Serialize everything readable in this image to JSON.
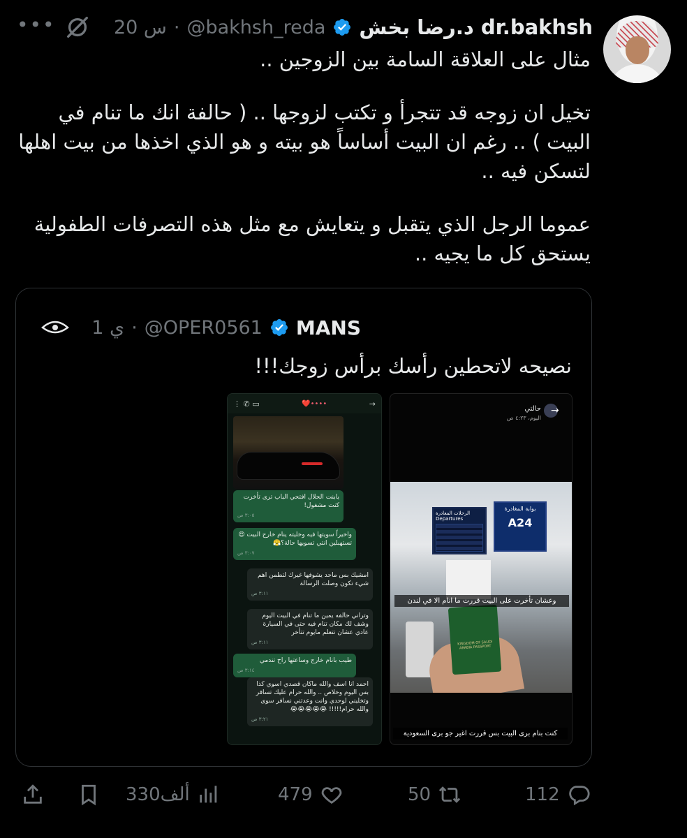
{
  "tweet": {
    "display_name": "د.رضا بخش dr.bakhsh",
    "handle": "@bakhsh_reda",
    "time": "20 س",
    "separator": "·",
    "more_label": "•••",
    "paragraphs": [
      "مثال على العلاقة السامة بين الزوجين ..",
      "تخيل ان زوجه قد تتجرأ و تكتب لزوجها .. ( حالفة انك ما تنام في البيت ) .. رغم ان البيت أساساً هو بيته و هو الذي اخذها من بيت اهلها لتسكن فيه ..",
      "عموما الرجل الذي يتقبل و يتعايش مع مثل هذه التصرفات الطفولية يستحق كل ما يجيه .."
    ]
  },
  "quote": {
    "display_name": "MANS",
    "handle": "@OPER0561",
    "time": "1 ي",
    "separator": "·",
    "text": "نصيحه لاتحطين رأسك برأس زوجك!!!",
    "left_image": {
      "contact": "❤️••••",
      "messages": [
        {
          "dir": "out",
          "text": "يابنت الحلال افتحي الباب ترى تأخرت كنت مشغول!",
          "time": "٣:٠٥ ص"
        },
        {
          "dir": "out",
          "text": "واخيراً سويتها فيه وخليته ينام خارج البيت 😍 تستهبلين انتي تسويها حالة؟😤",
          "time": "٣:٠٧ ص"
        },
        {
          "dir": "in",
          "text": "امشيك بس ماحد يشوفها غيرك لتطمن اهم شيء تكون وصلت الرسالة",
          "time": "٣:١١ ص"
        },
        {
          "dir": "in",
          "text": "وتراني حالفه يمين ما تنام في البيت اليوم وشف لك مكان تنام فيه حتى في السيارة عادي عشان تتعلم مايوم تتأخر",
          "time": "٣:١١ ص"
        },
        {
          "dir": "out",
          "text": "طيب بانام خارج وساعتها راح تندمي",
          "time": "٣:١٤ ص"
        },
        {
          "dir": "in",
          "text": "احمد انا اسف والله ماكان قصدي اسوي كذا بس اليوم وخلاص .. والله حرام عليك تسافر وتخليني لوحدي وانت وعدتني نسافر سوى والله حرام!!!!! 😭😭😭😭😭",
          "time": "٣:٢١ ص"
        }
      ]
    },
    "right_image": {
      "title": "حالتي",
      "subtitle": "اليوم، ٤:٢٣ ص",
      "board_departures": "الرحلات المغادرة Departures",
      "board_gate": "بوابة المغادرة",
      "gate_code": "A24",
      "caption_1": "وعشان تأخرت على البيت قررت ما انام الا في لندن",
      "caption_2": "كنت بنام برى البيت بس قررت اغير جو برى السعودية",
      "passport_text": "KINGDOM OF SAUDI ARABIA PASSPORT"
    }
  },
  "actions": {
    "replies": "112",
    "retweets": "50",
    "likes": "479",
    "views": "330ألف"
  },
  "colors": {
    "background": "#000000",
    "text": "#e7e9ea",
    "muted": "#71767b",
    "verified": "#1d9bf0",
    "border": "#2f3336"
  }
}
